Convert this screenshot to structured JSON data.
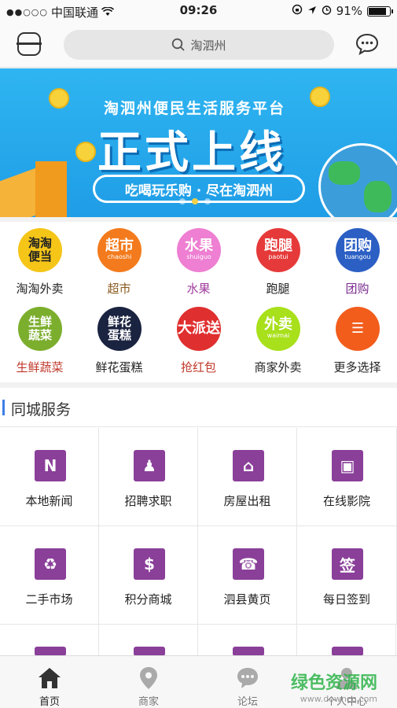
{
  "status_bar": {
    "carrier": "中国联通",
    "time": "09:26",
    "battery": "91%",
    "battery_level": 0.91
  },
  "header": {
    "search_placeholder": "淘泗州"
  },
  "banner": {
    "subtitle": "淘泗州便民生活服务平台",
    "headline": "正式上线",
    "slogan": "吃喝玩乐购 · 尽在淘泗州"
  },
  "categories": [
    {
      "label": "淘淘外卖",
      "icon_text": "淘淘便当",
      "color": "#f5c518",
      "label_color": "#222222"
    },
    {
      "label": "超市",
      "icon_text": "超市",
      "icon_sub": "chaoshi",
      "color": "#f37b1d",
      "label_color": "#8a5a1e"
    },
    {
      "label": "水果",
      "icon_text": "水果",
      "icon_sub": "shuiguo",
      "color": "#ee7fd2",
      "label_color": "#a03b9e"
    },
    {
      "label": "跑腿",
      "icon_text": "跑腿",
      "icon_sub": "paotui",
      "color": "#e63a3a",
      "label_color": "#222222"
    },
    {
      "label": "团购",
      "icon_text": "团购",
      "icon_sub": "tuangou",
      "color": "#2b5fc4",
      "label_color": "#7a2a8e"
    },
    {
      "label": "生鲜蔬菜",
      "icon_text": "生鲜蔬菜",
      "color": "#7cae2e",
      "label_color": "#c0392b"
    },
    {
      "label": "鲜花蛋糕",
      "icon_text": "鲜花蛋糕",
      "color": "#1a2340",
      "label_color": "#222222"
    },
    {
      "label": "抢红包",
      "icon_text": "大派送",
      "color": "#e02f2f",
      "label_color": "#c0392b"
    },
    {
      "label": "商家外卖",
      "icon_text": "外卖",
      "icon_sub": "waimai",
      "color": "#a8e01b",
      "label_color": "#222222"
    },
    {
      "label": "更多选择",
      "icon_text": "☰",
      "color": "#f25d1c",
      "label_color": "#222222"
    }
  ],
  "services": {
    "title": "同城服务",
    "items": [
      {
        "label": "本地新闻",
        "icon": "news-icon",
        "glyph": "N"
      },
      {
        "label": "招聘求职",
        "icon": "people-icon",
        "glyph": "♟"
      },
      {
        "label": "房屋出租",
        "icon": "shop-icon",
        "glyph": "⌂"
      },
      {
        "label": "在线影院",
        "icon": "projector-icon",
        "glyph": "▣"
      },
      {
        "label": "二手市场",
        "icon": "recycle-icon",
        "glyph": "♻"
      },
      {
        "label": "积分商城",
        "icon": "money-bag-icon",
        "glyph": "$"
      },
      {
        "label": "泗县黄页",
        "icon": "contacts-icon",
        "glyph": "☎"
      },
      {
        "label": "每日签到",
        "icon": "sign-icon",
        "glyph": "签"
      }
    ]
  },
  "tabbar": [
    {
      "label": "首页",
      "active": true
    },
    {
      "label": "商家",
      "active": false
    },
    {
      "label": "论坛",
      "active": false
    },
    {
      "label": "个人中心",
      "active": false
    }
  ],
  "watermark": {
    "text": "绿色资源网",
    "url": "www.downcc.com"
  }
}
